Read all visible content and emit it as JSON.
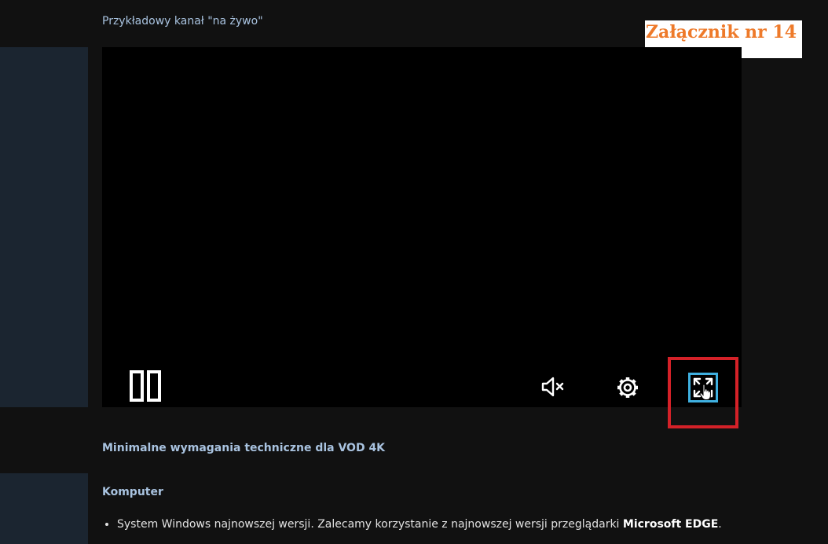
{
  "page": {
    "channel_title": "Przykładowy kanał \"na żywo\"",
    "annex_label": "Załącznik nr 14"
  },
  "player": {
    "controls": [
      {
        "name": "pause",
        "icon": "pause-icon"
      },
      {
        "name": "mute",
        "icon": "volume-muted-icon"
      },
      {
        "name": "settings",
        "icon": "gear-icon"
      },
      {
        "name": "fullscreen",
        "icon": "fullscreen-icon",
        "highlighted": true
      }
    ],
    "accent_color": "#3fb0e0",
    "highlight_color": "#d42128"
  },
  "requirements": {
    "title": "Minimalne wymagania techniczne dla VOD 4K",
    "computer_heading": "Komputer",
    "items": [
      {
        "text": "System Windows najnowszej wersji. Zalecamy korzystanie z najnowszej wersji przeglądarki ",
        "bold": "Microsoft EDGE",
        "suffix": "."
      }
    ]
  },
  "colors": {
    "background": "#111111",
    "side_panel": "#1b2530",
    "link_text": "#a9c3e0",
    "annex_text": "#ee7a2a"
  }
}
